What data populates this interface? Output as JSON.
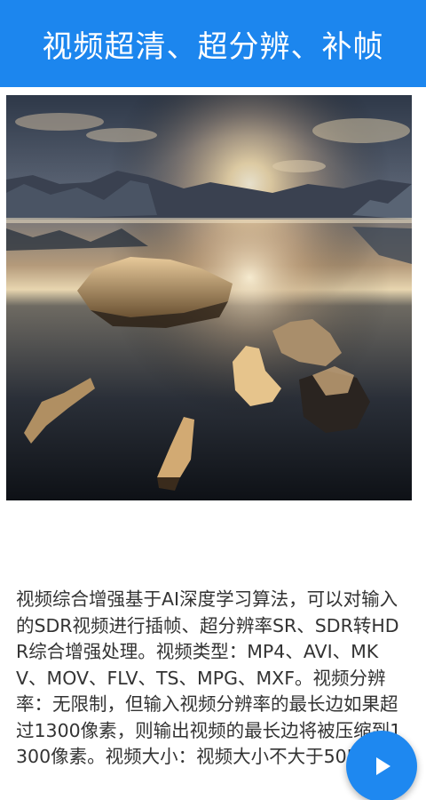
{
  "header": {
    "title": "视频超清、超分辨、补帧"
  },
  "preview": {
    "subject": "sunset over lake with ice floes"
  },
  "description": {
    "text": "视频综合增强基于AI深度学习算法，可以对输入的SDR视频进行插帧、超分辨率SR、SDR转HDR综合增强处理。视频类型：MP4、AVI、MKV、MOV、FLV、TS、MPG、MXF。视频分辨率：无限制，但输入视频分辨率的最长边如果超过1300像素，则输出视频的最长边将被压缩到1300像素。视频大小：视频大小不大于50M"
  },
  "fab": {
    "icon": "play-icon",
    "color": "#1e88f0"
  },
  "colors": {
    "header_bg": "#1c86ee",
    "header_text": "#ffffff",
    "body_text": "#333333"
  }
}
